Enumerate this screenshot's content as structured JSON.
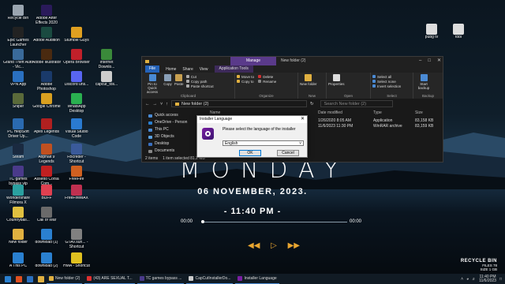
{
  "colors": {
    "accent": "#5a3a8a",
    "file_tab": "#2462b8",
    "gold": "#e8a530"
  },
  "desktop_icons": [
    {
      "label": "Recycle Bin",
      "color": "#9aa5b0",
      "icon": "recycle-bin-icon"
    },
    {
      "label": "Adobe After Effects 2020",
      "color": "#2a1a5a",
      "icon": "after-effects-icon"
    },
    {
      "label": "Epic Games Launcher",
      "color": "#222222",
      "icon": "epic-games-icon"
    },
    {
      "label": "Adobe Audition",
      "color": "#1a4a40",
      "icon": "audition-icon"
    },
    {
      "label": "Stumble Guys",
      "color": "#e0a020",
      "icon": "stumble-guys-icon"
    },
    {
      "label": "Grand Theft Auto - Vic...",
      "color": "#3a6a9a",
      "icon": "gta-icon"
    },
    {
      "label": "Adobe Illustrator",
      "color": "#4a2a10",
      "icon": "illustrator-icon"
    },
    {
      "label": "Opera Browser",
      "color": "#c0202a",
      "icon": "opera-icon"
    },
    {
      "label": "Internet Downlo...",
      "color": "#3a8a3a",
      "icon": "idm-icon"
    },
    {
      "label": "VPN App",
      "color": "#2a70c0",
      "icon": "vpn-icon"
    },
    {
      "label": "Adobe Photoshop",
      "color": "#1a3a6a",
      "icon": "photoshop-icon"
    },
    {
      "label": "Discord uns...",
      "color": "#5865f2",
      "icon": "discord-icon"
    },
    {
      "label": "capcut_tos...",
      "color": "#cccccc",
      "icon": "capcut-icon"
    },
    {
      "label": "Sniper",
      "color": "#5a6a3a",
      "icon": "sniper-icon"
    },
    {
      "label": "Google Chrome",
      "color": "#d9a020",
      "icon": "chrome-icon"
    },
    {
      "label": "WhatsApp Desktop",
      "color": "#2ab050",
      "icon": "whatsapp-icon"
    },
    {
      "label": "PC HelpSoft Driver Up...",
      "color": "#2a6ab0",
      "icon": "helpsoft-icon"
    },
    {
      "label": "Apex Legends",
      "color": "#b02020",
      "icon": "apex-icon"
    },
    {
      "label": "Visual Studio Code",
      "color": "#2a7ad0",
      "icon": "vscode-icon"
    },
    {
      "label": "Steam",
      "color": "#1a2a40",
      "icon": "steam-icon"
    },
    {
      "label": "Asphalt 9 Legends",
      "color": "#c05020",
      "icon": "asphalt-icon"
    },
    {
      "label": "FBcreder - Shortcut",
      "color": "#3a5a9a",
      "icon": "fb-icon"
    },
    {
      "label": "TC games bypass vip",
      "color": "#4a3a8a",
      "icon": "tcgames-icon"
    },
    {
      "label": "Assetto Corsa Com...",
      "color": "#c02020",
      "icon": "assetto-icon"
    },
    {
      "label": "FreeFire",
      "color": "#d06020",
      "icon": "freefire-icon"
    },
    {
      "label": "Wondershare Filmora X",
      "color": "#2aa0a0",
      "icon": "filmora-icon"
    },
    {
      "label": "BUFF",
      "color": "#e04050",
      "icon": "buff-icon"
    },
    {
      "label": "FreeFireMAX",
      "color": "#c03050",
      "icon": "freefiremax-icon"
    },
    {
      "label": "Countryball...",
      "color": "#e0c040",
      "icon": "countryball-icon"
    },
    {
      "label": "Call of War",
      "color": "#6a6a6a",
      "icon": "callofwar-icon"
    },
    {
      "label": "New folder",
      "color": "#e0b040",
      "icon": "folder-icon"
    },
    {
      "label": "GTAV.sun... - Shortcut",
      "color": "#808080",
      "icon": "gtav-icon"
    },
    {
      "label": "A This PC",
      "color": "#2a80d0",
      "icon": "thispc-icon"
    },
    {
      "label": "download (1)",
      "color": "#2a80d0",
      "icon": "download-icon"
    },
    {
      "label": "download (2)",
      "color": "#2a80d0",
      "icon": "download-icon"
    },
    {
      "label": "HMA - Shortcut",
      "color": "#e0c020",
      "icon": "hma-icon"
    },
    {
      "label": "pubg tv",
      "color": "#dddddd",
      "icon": "pubg-icon"
    },
    {
      "label": "tobi",
      "color": "#dddddd",
      "icon": "file-icon"
    }
  ],
  "wallpaper": {
    "day": "MONDAY",
    "date": "06 NOVEMBER, 2023.",
    "time": "- 11:40 PM -",
    "progress_left": "00:00",
    "progress_right": "00:00",
    "progress": 0.0
  },
  "recycle": {
    "title": "RECYCLE BIN",
    "files": "FILES 78",
    "size": "SIZE 1 GB"
  },
  "explorer": {
    "manage": "Manage",
    "window_name": "New folder (2)",
    "app_tools": "Application Tools",
    "tabs": [
      "File",
      "Home",
      "Share",
      "View"
    ],
    "ribbon": {
      "pin": "Pin to Quick access",
      "copy": "Copy",
      "paste": "Paste",
      "cut": "Cut",
      "copy_path": "Copy path",
      "paste_shortcut": "Paste shortcut",
      "clipboard": "Clipboard",
      "move_to": "Move to",
      "copy_to": "Copy to",
      "delete": "Delete",
      "rename": "Rename",
      "organize": "Organize",
      "new_folder": "New folder",
      "new": "New",
      "properties": "Properties",
      "open": "Open",
      "select_all": "Select all",
      "select_none": "Select none",
      "invert": "Invert selection",
      "select": "Select",
      "start_backup": "Start backup",
      "backup": "Backup"
    },
    "path": "New folder (2)",
    "search": "Search New folder (2)",
    "columns": {
      "name": "Name",
      "date": "Date modified",
      "type": "Type",
      "size": "Size"
    },
    "nav": [
      "Quick access",
      "OneDrive - Person",
      "This PC",
      "3D Objects",
      "Desktop",
      "Documents"
    ],
    "rows": [
      {
        "date": "1/26/2020 8:05 AM",
        "type": "Application",
        "size": "83,158 KB"
      },
      {
        "date": "11/6/2023 11:30 PM",
        "type": "WinRAR archive",
        "size": "83,159 KB"
      }
    ],
    "status_items": "2 items",
    "status_selected": "1 item selected  81.2 MB"
  },
  "dialog": {
    "title": "Installer Language",
    "close": "✕",
    "message": "Please select the language of the installer",
    "selected": "English",
    "ok": "OK",
    "cancel": "Cancel"
  },
  "taskbar": {
    "apps": [
      {
        "label": "New folder (2)",
        "color": "#e0b040"
      },
      {
        "label": "(43) ARE SEXUAL T...",
        "color": "#e03030"
      },
      {
        "label": "TC games bypass ...",
        "color": "#4a3a8a"
      },
      {
        "label": "CapCutInstallerDo...",
        "color": "#cccccc"
      },
      {
        "label": "Installer Language",
        "color": "#7a1fa2"
      }
    ],
    "time": "11:40 PM",
    "date": "11/6/2023"
  }
}
